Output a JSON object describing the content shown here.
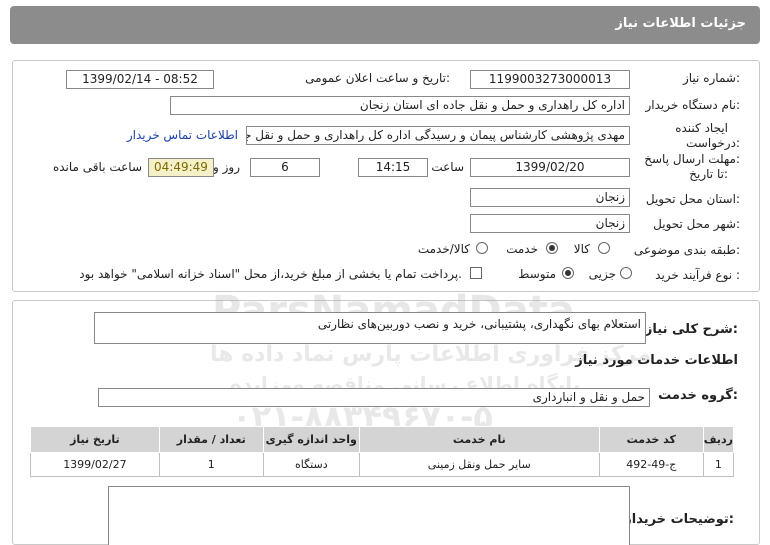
{
  "page": {
    "title": "جزئیات اطلاعات نیاز"
  },
  "fields": {
    "need_number_label": "شماره نیاز:",
    "need_number": "1199003273000013",
    "announce_label": "تاریخ و ساعت اعلان عمومی:",
    "announce_value": "1399/02/14 - 08:52",
    "buyer_org_label": "نام دستگاه خریدار:",
    "buyer_org": "اداره کل راهداری و حمل و نقل جاده ای استان زنجان",
    "creator_label_1": "ایجاد کننده",
    "creator_label_2": "درخواست:",
    "creator": "مهدی پژوهشی کارشناس پیمان و رسیدگی اداره کل راهداری و حمل و نقل جاده",
    "contact_link": "اطلاعات تماس خریدار",
    "deadline_label_1": "مهلت ارسال پاسخ:",
    "deadline_label_2": "تا تاریخ:",
    "deadline_date": "1399/02/20",
    "time_label": "ساعت",
    "deadline_time": "14:15",
    "days_value": "6",
    "days_label": "روز و",
    "remaining_value": "04:49:49",
    "remaining_label": "ساعت باقی مانده",
    "province_label": "استان محل تحویل:",
    "province": "زنجان",
    "city_label": "شهر محل تحویل:",
    "city": "زنجان",
    "category_label": "طبقه بندی موضوعی:",
    "category_options": [
      "کالا",
      "خدمت",
      "کالا/خدمت"
    ],
    "process_label": "نوع فرآیند خرید :",
    "process_options": [
      "جزیی",
      "متوسط"
    ],
    "payment_note": "پرداخت تمام یا بخشی از مبلغ خرید،از محل \"اسناد خزانه اسلامی\" خواهد بود."
  },
  "general_desc": {
    "label": "شرح کلی نیاز:",
    "value": "استعلام بهای نگهداری، پشتیبانی، خرید و نصب دوربین‌های نظارتی"
  },
  "services": {
    "section_title": "اطلاعات خدمات مورد نیاز",
    "group_label": "گروه خدمت:",
    "group_value": "حمل و نقل و انبارداری",
    "columns": [
      "ردیف",
      "کد خدمت",
      "نام خدمت",
      "واحد اندازه گیری",
      "تعداد / مقدار",
      "تاریخ نیاز"
    ],
    "rows": [
      [
        "1",
        "ج-49-492",
        "سایر حمل ونقل زمینی",
        "دستگاه",
        "1",
        "1399/02/27"
      ]
    ]
  },
  "buyer_notes": {
    "label": "توضیحات خریدار:",
    "value": ""
  },
  "watermark": {
    "brand": "ParsNamadData",
    "line1": "مرکز فراوری اطلاعات پارس نماد داده ها",
    "line2": "پایگاه اطلاع رسانی مناقصه ومزایده",
    "phone": "۰۲۱-۸۸۳۴۹۶۷۰-۵"
  }
}
